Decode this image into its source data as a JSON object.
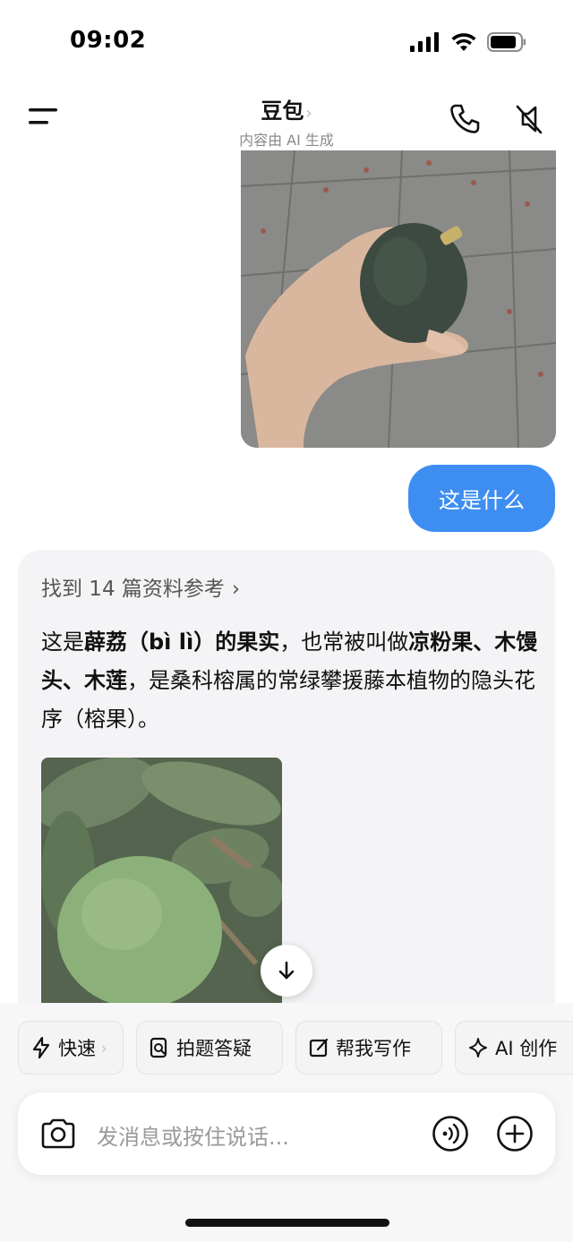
{
  "status_bar": {
    "time": "09:02"
  },
  "header": {
    "title": "豆包",
    "subtitle": "内容由 AI 生成"
  },
  "user_message": {
    "text": "这是什么"
  },
  "answer": {
    "references": "找到 14 篇资料参考",
    "segments": [
      {
        "t": "这是",
        "b": false
      },
      {
        "t": "薜荔（bì lì）的果实",
        "b": true
      },
      {
        "t": "，也常被叫做",
        "b": false
      },
      {
        "t": "凉粉果、木馒头、木莲",
        "b": true
      },
      {
        "t": "，是桑科榕属的常绿攀援藤本植物的隐头花序（榕果）。",
        "b": false
      }
    ]
  },
  "chips": [
    {
      "label": "快速",
      "icon": "lightning-icon"
    },
    {
      "label": "拍题答疑",
      "icon": "photo-question-icon"
    },
    {
      "label": "帮我写作",
      "icon": "edit-icon"
    },
    {
      "label": "AI 创作",
      "icon": "sparkle-icon"
    }
  ],
  "input": {
    "placeholder": "发消息或按住说话..."
  },
  "colors": {
    "accent": "#3e8ef2",
    "card_bg": "#f4f4f6"
  }
}
